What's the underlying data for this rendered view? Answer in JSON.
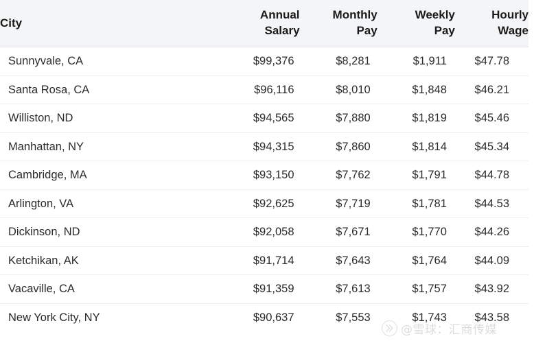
{
  "table": {
    "columns": [
      {
        "key": "city",
        "label": "City",
        "align": "left"
      },
      {
        "key": "annual",
        "label": "Annual\nSalary",
        "align": "right"
      },
      {
        "key": "monthly",
        "label": "Monthly\nPay",
        "align": "right"
      },
      {
        "key": "weekly",
        "label": "Weekly\nPay",
        "align": "right"
      },
      {
        "key": "hourly",
        "label": "Hourly\nWage",
        "align": "right"
      }
    ],
    "rows": [
      {
        "city": "Sunnyvale, CA",
        "annual": "$99,376",
        "monthly": "$8,281",
        "weekly": "$1,911",
        "hourly": "$47.78"
      },
      {
        "city": "Santa Rosa, CA",
        "annual": "$96,116",
        "monthly": "$8,010",
        "weekly": "$1,848",
        "hourly": "$46.21"
      },
      {
        "city": "Williston, ND",
        "annual": "$94,565",
        "monthly": "$7,880",
        "weekly": "$1,819",
        "hourly": "$45.46"
      },
      {
        "city": "Manhattan, NY",
        "annual": "$94,315",
        "monthly": "$7,860",
        "weekly": "$1,814",
        "hourly": "$45.34"
      },
      {
        "city": "Cambridge, MA",
        "annual": "$93,150",
        "monthly": "$7,762",
        "weekly": "$1,791",
        "hourly": "$44.78"
      },
      {
        "city": "Arlington, VA",
        "annual": "$92,625",
        "monthly": "$7,719",
        "weekly": "$1,781",
        "hourly": "$44.53"
      },
      {
        "city": "Dickinson, ND",
        "annual": "$92,058",
        "monthly": "$7,671",
        "weekly": "$1,770",
        "hourly": "$44.26"
      },
      {
        "city": "Ketchikan, AK",
        "annual": "$91,714",
        "monthly": "$7,643",
        "weekly": "$1,764",
        "hourly": "$44.09"
      },
      {
        "city": "Vacaville, CA",
        "annual": "$91,359",
        "monthly": "$7,613",
        "weekly": "$1,757",
        "hourly": "$43.92"
      },
      {
        "city": "New York City, NY",
        "annual": "$90,637",
        "monthly": "$7,553",
        "weekly": "$1,743",
        "hourly": "$43.58"
      }
    ]
  },
  "watermark": {
    "logo_icon": "xueqiu-logo-icon",
    "text": "@雪球：汇商传媒"
  },
  "colors": {
    "header_background": "#f4f5f7",
    "row_background": "#ffffff",
    "row_divider": "#eceef1",
    "header_divider": "#e3e4e8",
    "header_text": "#1a1a1a",
    "body_text": "#2b2b2b",
    "watermark_text": "#8e8e8e"
  }
}
